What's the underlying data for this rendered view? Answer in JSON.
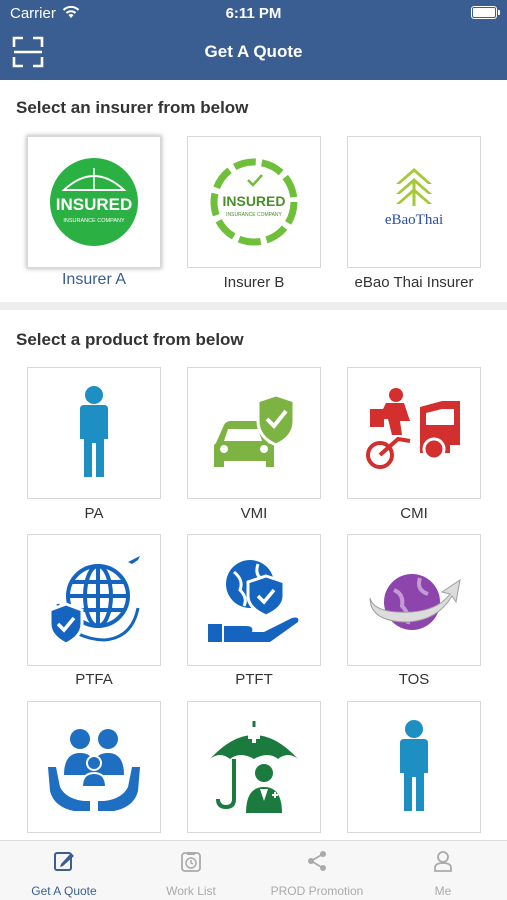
{
  "status_bar": {
    "carrier": "Carrier",
    "time": "6:11 PM"
  },
  "header": {
    "title": "Get A Quote"
  },
  "insurer_section": {
    "title": "Select an insurer from below",
    "insurers": [
      {
        "label": "Insurer A",
        "logo_text": "INSURED",
        "logo_sub": "INSURANCE COMPANY",
        "selected": true
      },
      {
        "label": "Insurer B",
        "logo_text": "INSURED",
        "logo_sub": "INSURANCE COMPANY",
        "selected": false
      },
      {
        "label": "eBao Thai Insurer",
        "logo_text": "eBaoThai",
        "selected": false
      }
    ]
  },
  "product_section": {
    "title": "Select a product from below",
    "products": [
      {
        "label": "PA",
        "icon": "person-icon"
      },
      {
        "label": "VMI",
        "icon": "car-shield-icon"
      },
      {
        "label": "CMI",
        "icon": "motorcycle-car-crash-icon"
      },
      {
        "label": "PTFA",
        "icon": "globe-shield-plane-icon"
      },
      {
        "label": "PTFT",
        "icon": "globe-hand-shield-icon"
      },
      {
        "label": "TOS",
        "icon": "planet-arrow-icon"
      },
      {
        "label": "",
        "icon": "family-hands-icon"
      },
      {
        "label": "",
        "icon": "umbrella-doctor-icon"
      },
      {
        "label": "",
        "icon": "person-icon"
      }
    ]
  },
  "tabbar": {
    "tabs": [
      {
        "label": "Get A Quote",
        "icon": "edit-icon",
        "active": true
      },
      {
        "label": "Work List",
        "icon": "clipboard-timer-icon",
        "active": false
      },
      {
        "label": "PROD Promotion",
        "icon": "share-icon",
        "active": false
      },
      {
        "label": "Me",
        "icon": "user-icon",
        "active": false
      }
    ]
  },
  "colors": {
    "header_bg": "#3a5e92",
    "person_blue": "#1e8fc2",
    "vmi_green": "#7cb342",
    "cmi_red": "#d32f2f",
    "ptf_blue": "#1565c0",
    "tos_purple": "#8e44ad",
    "umbrella_green": "#1b7a3e"
  }
}
